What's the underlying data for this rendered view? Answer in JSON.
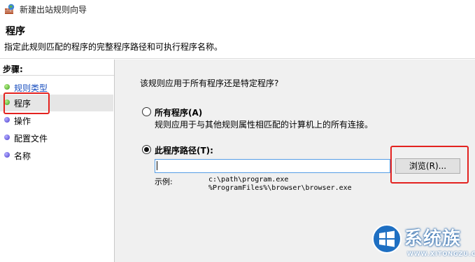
{
  "window": {
    "title": "新建出站规则向导"
  },
  "header": {
    "title": "程序",
    "description": "指定此规则匹配的程序的完整程序路径和可执行程序名称。"
  },
  "sidebar": {
    "heading": "步骤:",
    "items": [
      {
        "label": "规则类型",
        "status": "done"
      },
      {
        "label": "程序",
        "status": "current"
      },
      {
        "label": "操作",
        "status": "pending"
      },
      {
        "label": "配置文件",
        "status": "pending"
      },
      {
        "label": "名称",
        "status": "pending"
      }
    ]
  },
  "main": {
    "question": "该规则应用于所有程序还是特定程序?",
    "option_all": {
      "label": "所有程序(A)",
      "description": "规则应用于与其他规则属性相匹配的计算机上的所有连接。",
      "selected": false
    },
    "option_path": {
      "label": "此程序路径(T):",
      "selected": true
    },
    "path_input": {
      "value": ""
    },
    "browse_label": "浏览(R)...",
    "example_label": "示例:",
    "example_lines": [
      "c:\\path\\program.exe",
      "%ProgramFiles%\\browser\\browser.exe"
    ]
  },
  "watermark": {
    "text": "系统族",
    "url": "WWW.XITONGZU.COM"
  },
  "colors": {
    "highlight": "#e3221f",
    "link": "#1a4fbf",
    "content_bg": "#f0f0f0",
    "input_focus": "#569de5"
  }
}
